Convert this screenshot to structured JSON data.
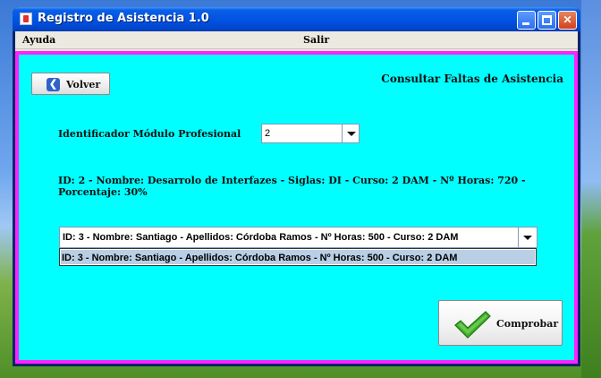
{
  "window": {
    "title": "Registro de Asistencia 1.0"
  },
  "menu": {
    "items": [
      "Ayuda",
      "Salir"
    ]
  },
  "panel": {
    "back_button": "Volver",
    "heading": "Consultar Faltas de Asistencia",
    "module_label": "Identificador Módulo Profesional",
    "module_select": {
      "value": "2"
    },
    "module_info": "ID: 2 - Nombre: Desarrolo de Interfazes - Siglas: DI - Curso: 2 DAM - Nº Horas: 720 - Porcentaje: 30%",
    "student_select": {
      "value": "ID: 3 - Nombre: Santiago - Apellidos: Córdoba Ramos - Nº Horas: 500 - Curso: 2 DAM",
      "options": [
        "ID: 3 - Nombre: Santiago - Apellidos: Córdoba Ramos - Nº Horas: 500 - Curso: 2 DAM"
      ]
    },
    "check_button": "Comprobar"
  },
  "colors": {
    "panel_bg": "#00ffff",
    "panel_border": "#ff22ff",
    "titlebar": "#0054e3",
    "check_icon": "#3fae2a"
  },
  "icons": {
    "back": "arrow-left-icon",
    "check": "checkmark-icon"
  }
}
